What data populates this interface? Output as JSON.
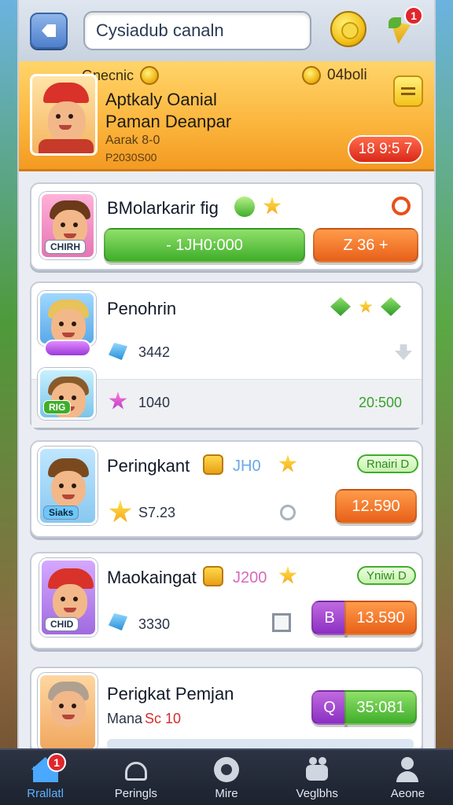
{
  "topbar": {
    "search_value": "Cysiadub canaln",
    "notification_count": "1"
  },
  "hero": {
    "tab_label": "Gnecnic",
    "coins": "04boli",
    "title_line1": "Aptkaly Oanial",
    "title_line2": "Paman Deanpar",
    "subtitle1": "Aarak 8-0",
    "subtitle2": "P2030S00",
    "pill_value": "18 9:5 7"
  },
  "cards": [
    {
      "title": "BMolarkarir fig",
      "thumb_label": "CHIRH",
      "green_btn": "- 1JH0:000",
      "orange_btn": "Z 36 +"
    },
    {
      "title": "Penohrin",
      "thumb_label": "RIG",
      "row1_value": "3442",
      "row2_value": "1040",
      "row2_right": "20:500"
    },
    {
      "title": "Peringkant",
      "score": "JH0",
      "tag": "Rnairi D",
      "thumb_label": "Siaks",
      "row_value": "S7.23",
      "orange_btn": "12.590"
    },
    {
      "title": "Maokaingat",
      "score": "J200",
      "tag": "Yniwi D",
      "thumb_label": "CHID",
      "row_value": "3330",
      "purple_label": "B",
      "orange_btn": "13.590"
    },
    {
      "title": "Perigkat Pemjan",
      "sub_label": "Mana",
      "sub_value": "Sc 10",
      "purple_label": "Q",
      "green_btn": "35:081"
    }
  ],
  "nav": {
    "items": [
      "Rrallatl",
      "Peringls",
      "Mire",
      "Veglbhs",
      "Aeone"
    ],
    "badge": "1"
  },
  "colors": {
    "accent_orange": "#f39a22",
    "accent_green": "#3fae2a",
    "badge_red": "#e0262c"
  }
}
